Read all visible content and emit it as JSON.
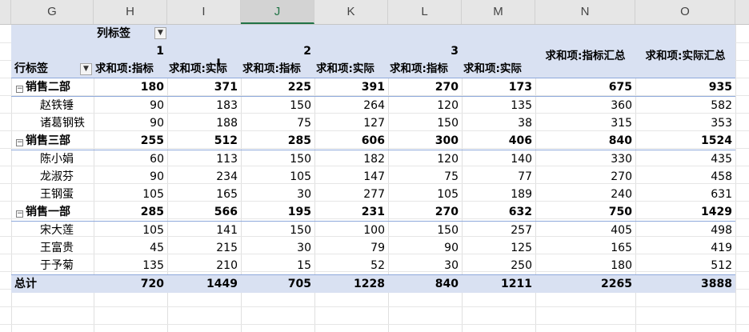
{
  "column_headers": [
    "G",
    "H",
    "I",
    "J",
    "K",
    "L",
    "M",
    "N",
    "O"
  ],
  "selected_column": "J",
  "colors": {
    "header_band": "#d9e1f2",
    "separator": "#8ea9db",
    "selected_accent": "#217346"
  },
  "pivot": {
    "col_label_field": "列标签",
    "row_label_field": "行标签",
    "col_groups": [
      "1",
      "2",
      "3"
    ],
    "measure_headers": [
      "求和项:指标",
      "求和项:实际",
      "求和项:指标",
      "求和项:实际",
      "求和项:指标",
      "求和项:实际",
      "求和项:指标汇总",
      "求和项:实际汇总"
    ],
    "expand_glyph": "⊟",
    "dropdown_glyph": "▼",
    "rows": [
      {
        "label": "销售二部",
        "bold": true,
        "group": true,
        "values": [
          "180",
          "371",
          "225",
          "391",
          "270",
          "173",
          "675",
          "935"
        ]
      },
      {
        "label": "赵铁锤",
        "bold": false,
        "group": false,
        "values": [
          "90",
          "183",
          "150",
          "264",
          "120",
          "135",
          "360",
          "582"
        ]
      },
      {
        "label": "诸葛钢铁",
        "bold": false,
        "group": false,
        "values": [
          "90",
          "188",
          "75",
          "127",
          "150",
          "38",
          "315",
          "353"
        ]
      },
      {
        "label": "销售三部",
        "bold": true,
        "group": true,
        "values": [
          "255",
          "512",
          "285",
          "606",
          "300",
          "406",
          "840",
          "1524"
        ]
      },
      {
        "label": "陈小娟",
        "bold": false,
        "group": false,
        "values": [
          "60",
          "113",
          "150",
          "182",
          "120",
          "140",
          "330",
          "435"
        ]
      },
      {
        "label": "龙淑芬",
        "bold": false,
        "group": false,
        "values": [
          "90",
          "234",
          "105",
          "147",
          "75",
          "77",
          "270",
          "458"
        ]
      },
      {
        "label": "王钢蛋",
        "bold": false,
        "group": false,
        "values": [
          "105",
          "165",
          "30",
          "277",
          "105",
          "189",
          "240",
          "631"
        ]
      },
      {
        "label": "销售一部",
        "bold": true,
        "group": true,
        "values": [
          "285",
          "566",
          "195",
          "231",
          "270",
          "632",
          "750",
          "1429"
        ]
      },
      {
        "label": "宋大莲",
        "bold": false,
        "group": false,
        "values": [
          "105",
          "141",
          "150",
          "100",
          "150",
          "257",
          "405",
          "498"
        ]
      },
      {
        "label": "王富贵",
        "bold": false,
        "group": false,
        "values": [
          "45",
          "215",
          "30",
          "79",
          "90",
          "125",
          "165",
          "419"
        ]
      },
      {
        "label": "于予菊",
        "bold": false,
        "group": false,
        "values": [
          "135",
          "210",
          "15",
          "52",
          "30",
          "250",
          "180",
          "512"
        ]
      }
    ],
    "total": {
      "label": "总计",
      "values": [
        "720",
        "1449",
        "705",
        "1228",
        "840",
        "1211",
        "2265",
        "3888"
      ]
    }
  }
}
